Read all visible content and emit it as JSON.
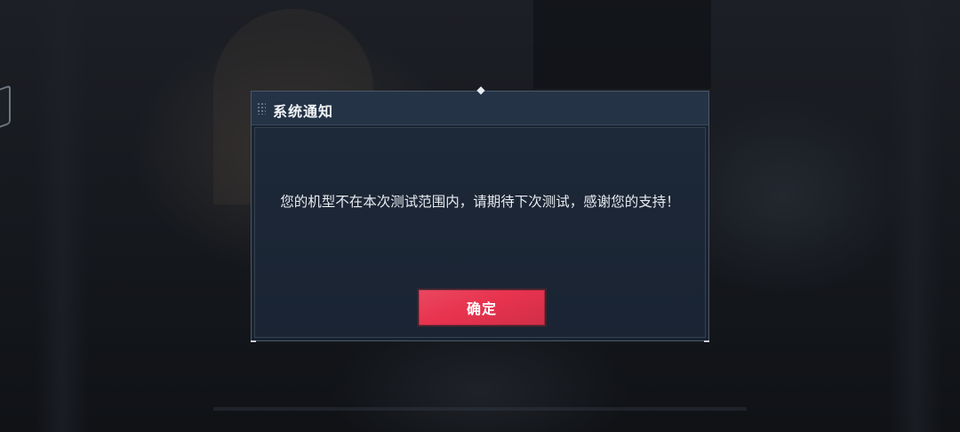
{
  "dialog": {
    "title": "系统通知",
    "message": "您的机型不在本次测试范围内，请期待下次测试，感谢您的支持！",
    "confirm_label": "确定"
  },
  "colors": {
    "accent": "#e8334f",
    "dialog_bg": "#1a2331",
    "title_bar_bg": "#243346"
  },
  "icons": {
    "top_marker": "diamond-marker-icon",
    "title_grip": "drag-grip-icon"
  }
}
